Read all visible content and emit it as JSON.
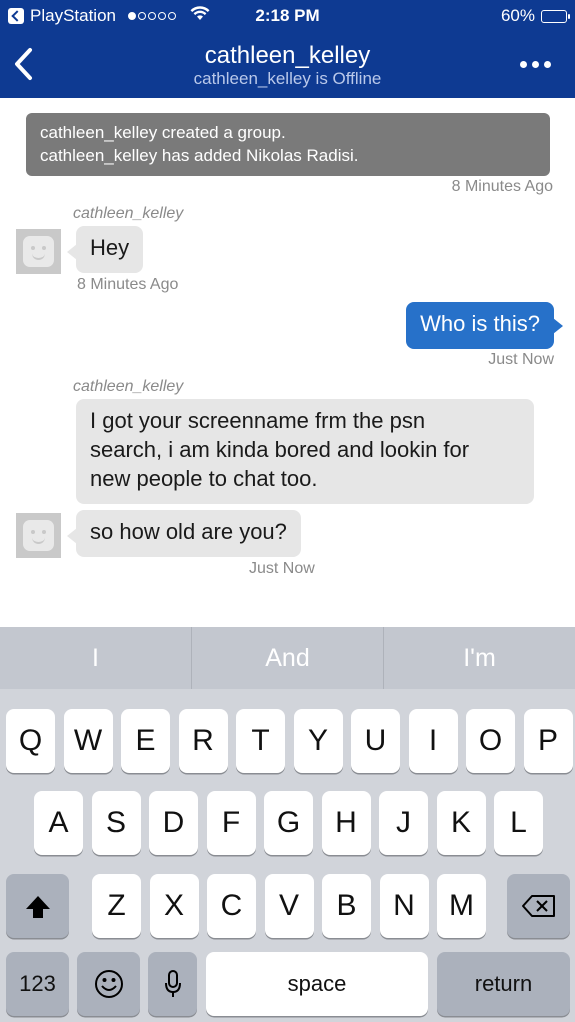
{
  "status_bar": {
    "carrier": "PlayStation",
    "signal_filled": 1,
    "signal_total": 5,
    "time": "2:18 PM",
    "battery": "60%",
    "battery_level": 0.6
  },
  "nav": {
    "title": "cathleen_kelley",
    "subtitle": "cathleen_kelley is Offline"
  },
  "chat": {
    "system": {
      "line1": "cathleen_kelley created a group.",
      "line2": "cathleen_kelley has added Nikolas Radisi.",
      "time": "8 Minutes Ago"
    },
    "messages": [
      {
        "sender": "cathleen_kelley",
        "text": "Hey",
        "time": "8 Minutes Ago"
      },
      {
        "text": "Who is this?",
        "time": "Just Now"
      },
      {
        "sender": "cathleen_kelley",
        "line1": "I got your screenname frm the psn",
        "line2": "search, i am kinda bored and lookin for",
        "line3": "new people to chat too."
      },
      {
        "text": "so how old are you?",
        "time": "Just Now"
      }
    ]
  },
  "keyboard": {
    "suggestions": [
      "I",
      "And",
      "I'm"
    ],
    "row1": [
      "Q",
      "W",
      "E",
      "R",
      "T",
      "Y",
      "U",
      "I",
      "O",
      "P"
    ],
    "row2": [
      "A",
      "S",
      "D",
      "F",
      "G",
      "H",
      "J",
      "K",
      "L"
    ],
    "row3": [
      "Z",
      "X",
      "C",
      "V",
      "B",
      "N",
      "M"
    ],
    "numbers_label": "123",
    "space_label": "space",
    "return_label": "return",
    "icons": {
      "shift": "shift-arrow-icon",
      "delete": "backspace-icon",
      "emoji": "emoji-icon",
      "mic": "microphone-icon"
    }
  },
  "colors": {
    "nav_bg": "#0e3a92",
    "outgoing_bubble": "#2771c9",
    "incoming_bubble": "#e6e6e6",
    "system_bubble": "#7a7a7a",
    "keyboard_bg": "#d1d4da"
  }
}
